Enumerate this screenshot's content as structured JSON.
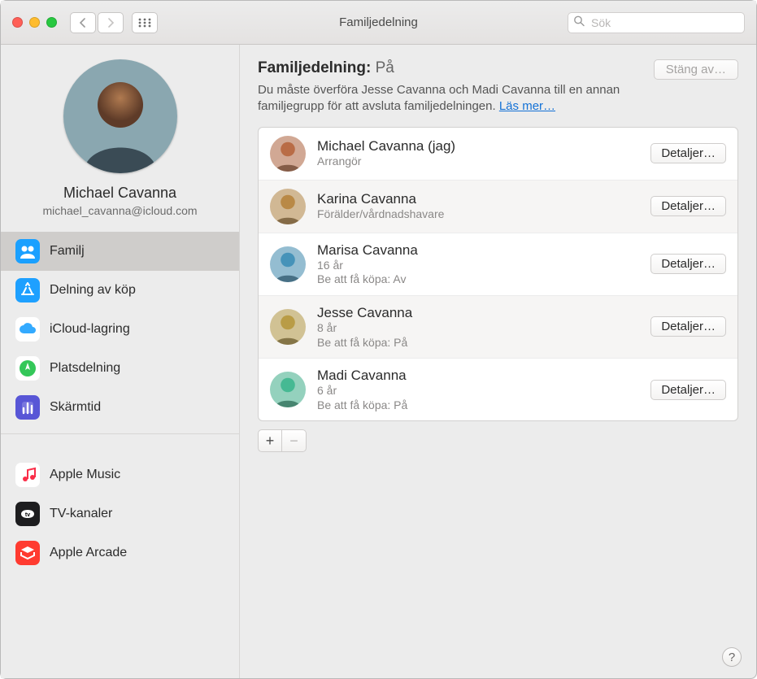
{
  "window": {
    "title": "Familjedelning"
  },
  "search": {
    "placeholder": "Sök"
  },
  "user": {
    "name": "Michael Cavanna",
    "email": "michael_cavanna@icloud.com"
  },
  "sidebar": {
    "items": [
      {
        "label": "Familj",
        "icon": "family-icon",
        "bg": "#1aa0ff",
        "selected": true
      },
      {
        "label": "Delning av köp",
        "icon": "appstore-icon",
        "bg": "#1ea0ff"
      },
      {
        "label": "iCloud-lagring",
        "icon": "cloud-icon",
        "bg": "#ffffff"
      },
      {
        "label": "Platsdelning",
        "icon": "location-icon",
        "bg": "#ffffff"
      },
      {
        "label": "Skärmtid",
        "icon": "screentime-icon",
        "bg": "#5856d6"
      }
    ],
    "items2": [
      {
        "label": "Apple Music",
        "icon": "music-icon",
        "bg": "#ffffff"
      },
      {
        "label": "TV-kanaler",
        "icon": "tv-icon",
        "bg": "#1d1d1f"
      },
      {
        "label": "Apple Arcade",
        "icon": "arcade-icon",
        "bg": "#ff3b30"
      }
    ]
  },
  "main": {
    "heading_prefix": "Familjedelning: ",
    "heading_state": "På",
    "turn_off_label": "Stäng av…",
    "note": "Du måste överföra Jesse Cavanna och Madi Cavanna till en annan familjegrupp för att avsluta familjedelningen. ",
    "learn_more_label": "Läs mer…",
    "details_label": "Detaljer…",
    "members": [
      {
        "name": "Michael Cavanna (jag)",
        "role": "Arrangör",
        "age": "",
        "ask": "",
        "hue": 20
      },
      {
        "name": "Karina Cavanna",
        "role": "Förälder/vårdnadshavare",
        "age": "",
        "ask": "",
        "hue": 35
      },
      {
        "name": "Marisa Cavanna",
        "role": "",
        "age": "16 år",
        "ask": "Be att få köpa: Av",
        "hue": 200
      },
      {
        "name": "Jesse Cavanna",
        "role": "",
        "age": "8 år",
        "ask": "Be att få köpa: På",
        "hue": 45
      },
      {
        "name": "Madi Cavanna",
        "role": "",
        "age": "6 år",
        "ask": "Be att få köpa: På",
        "hue": 160
      }
    ],
    "add_label": "+",
    "remove_label": "−"
  }
}
